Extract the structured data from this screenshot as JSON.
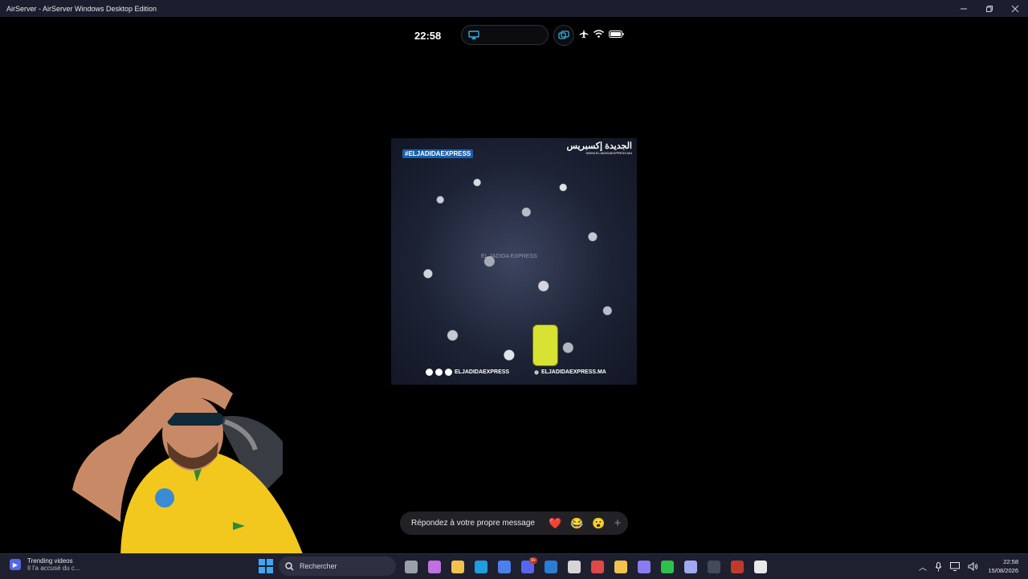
{
  "window": {
    "title": "AirServer - AirServer Windows Desktop Edition",
    "minimize_icon": "minimize-icon",
    "maximize_icon": "restore-icon",
    "close_icon": "close-icon"
  },
  "phone": {
    "time": "22:58",
    "airplay_icon": "airplay-icon",
    "mirror_icon": "screen-mirror-icon",
    "status_icons": [
      "airplane-icon",
      "wifi-icon",
      "battery-icon"
    ]
  },
  "video": {
    "hashtag": "#ELJADIDAEXPRESS",
    "logo_text": "الجديدة إكسبريس",
    "logo_site": "WWW.ELJADIDAEXPRESS.MA",
    "watermark": "EL JADIDA EXPRESS",
    "bottom_handle": "ELJADIDAEXPRESS",
    "bottom_site": "ELJADIDAEXPRESS.MA"
  },
  "reply_bar": {
    "placeholder": "Répondez à votre propre message",
    "reactions": [
      "❤️",
      "😂",
      "😮"
    ],
    "add_label": "+"
  },
  "taskbar": {
    "widget_title": "Trending videos",
    "widget_subtitle": "Il l'a accusé du c...",
    "search_placeholder": "Rechercher",
    "apps": [
      {
        "name": "task-view",
        "color": "#9aa0aa"
      },
      {
        "name": "copilot",
        "color": "#c070e0"
      },
      {
        "name": "file-explorer",
        "color": "#f2c14e"
      },
      {
        "name": "edge",
        "color": "#1f9de0"
      },
      {
        "name": "store",
        "color": "#4c7ef0"
      },
      {
        "name": "discord",
        "color": "#5865f2",
        "badge": "9+"
      },
      {
        "name": "mail",
        "color": "#2b7cd3"
      },
      {
        "name": "capture",
        "color": "#d6d6d6"
      },
      {
        "name": "timer",
        "color": "#e04848"
      },
      {
        "name": "chrome",
        "color": "#f2c14e"
      },
      {
        "name": "game-controller",
        "color": "#8a7cf0"
      },
      {
        "name": "nvidia",
        "color": "#2fbf4a"
      },
      {
        "name": "chat",
        "color": "#a0a8f0"
      },
      {
        "name": "obs",
        "color": "#444a5a"
      },
      {
        "name": "news",
        "color": "#c0392b"
      },
      {
        "name": "capcut",
        "color": "#e8e8ea"
      }
    ],
    "tray_icons": [
      "chevron-up-icon",
      "microphone-icon",
      "display-icon",
      "speaker-icon"
    ],
    "clock_time": "22:58",
    "clock_date": "15/08/2026"
  }
}
